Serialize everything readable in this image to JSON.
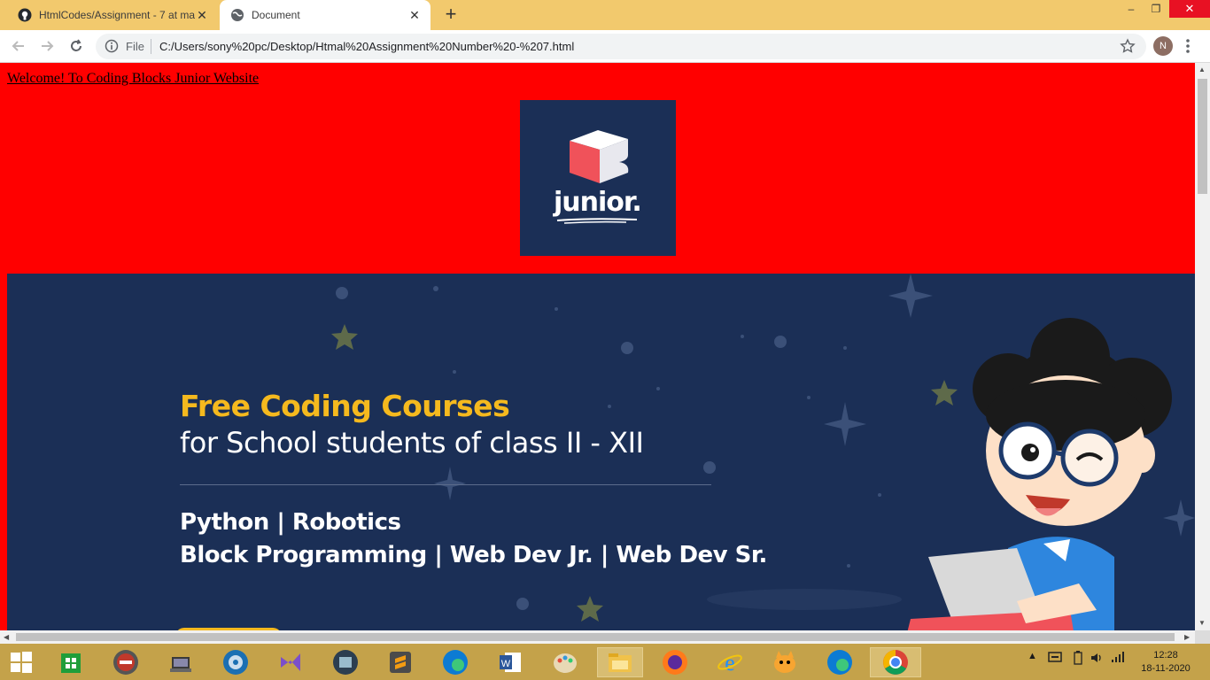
{
  "browser": {
    "tabs": [
      {
        "title": "HtmlCodes/Assignment - 7 at ma",
        "favicon": "github-icon",
        "active": false
      },
      {
        "title": "Document",
        "favicon": "globe-icon",
        "active": true
      }
    ],
    "omnibox": {
      "scheme_label": "File",
      "url": "C:/Users/sony%20pc/Desktop/Htmal%20Assignment%20Number%20-%207.html"
    },
    "profile_initial": "N",
    "window_controls": {
      "minimize": "–",
      "restore": "❐",
      "close": "✕"
    }
  },
  "page": {
    "welcome_link": "Welcome! To Coding Blocks Junior Website",
    "logo_text": "junior.",
    "banner": {
      "headline": "Free Coding Courses",
      "subheadline": "for School students of class II - XII",
      "courses_line1": "Python | Robotics",
      "courses_line2": "Block Programming | Web Dev Jr. | Web Dev Sr."
    }
  },
  "taskbar": {
    "apps": [
      "start-icon",
      "store-icon",
      "audio-app-icon",
      "network-app-icon",
      "media-icon",
      "visual-studio-icon",
      "film-icon",
      "sublime-icon",
      "edge-icon",
      "word-icon",
      "paint-icon",
      "file-explorer-icon",
      "firefox-icon",
      "ie-icon",
      "scratch-icon",
      "edge-icon",
      "chrome-icon"
    ],
    "clock_time": "12:28",
    "clock_date": "18-11-2020"
  },
  "colors": {
    "tabstrip": "#f2c96d",
    "page_background": "#ff0000",
    "banner": "#1b2f56",
    "headline": "#f5b91e",
    "taskbar": "#c4a24a"
  }
}
